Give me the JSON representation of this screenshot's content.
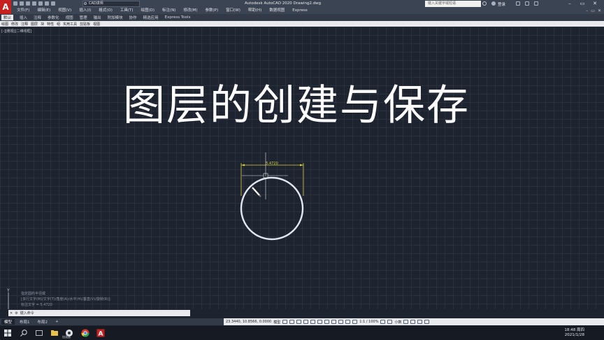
{
  "titlebar": {
    "logo": "A",
    "workspace": "CAD讲师",
    "app_title": "Autodesk AutoCAD 2020    Drawing2.dwg",
    "search_placeholder": "键入关键字或短语",
    "login": "登录",
    "window_buttons": [
      "–",
      "▭",
      "✕"
    ]
  },
  "menubar": {
    "items": [
      "文件(F)",
      "编辑(E)",
      "视图(V)",
      "插入(I)",
      "格式(O)",
      "工具(T)",
      "绘图(D)",
      "标注(N)",
      "修改(M)",
      "参数(P)",
      "窗口(W)",
      "帮助(H)",
      "数据视图",
      "Express"
    ],
    "right_controls": [
      "–",
      "▭",
      "✕"
    ]
  },
  "ribbon": {
    "tabs": [
      "默认",
      "插入",
      "注释",
      "参数化",
      "视图",
      "管理",
      "输出",
      "附加模块",
      "协作",
      "精选应用",
      "Express Tools"
    ],
    "active_tab": "默认",
    "panels": [
      "绘图",
      "修改",
      "注释",
      "图层",
      "块",
      "特性",
      "组",
      "实用工具",
      "剪贴板",
      "视图"
    ]
  },
  "viewport": {
    "label": "[-][俯视][二维线框]",
    "overlay_title": "图层的创建与保存",
    "dimension_value": "5.4720"
  },
  "command": {
    "history": [
      "指定圆的半径或",
      "[多行文字(M)/文字(T)/角度(A)/水平(H)/垂直(V)/旋转(R)]:",
      "标注文字 = 5.4720"
    ],
    "prompt": "键入命令"
  },
  "layout_tabs": [
    "模型",
    "布局1",
    "布局2",
    "+"
  ],
  "statusbar": {
    "coords": "23.3440, 10.8566, 0.0000",
    "model": "模型",
    "scale": "1:1 / 100%",
    "units": "小数"
  },
  "taskbar": {
    "time": "18:48 周四",
    "date": "2021/1/28",
    "label": "加速器"
  }
}
